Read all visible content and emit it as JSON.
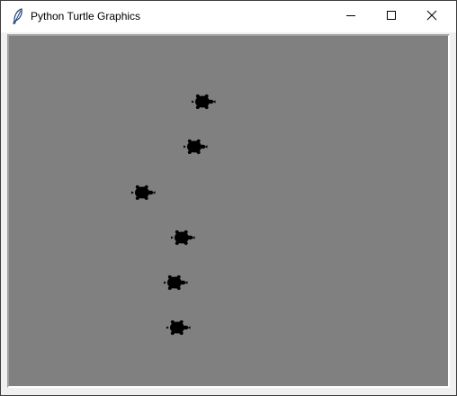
{
  "window": {
    "title": "Python Turtle Graphics",
    "icon": "feather-icon",
    "controls": [
      "minimize-icon",
      "maximize-icon",
      "close-icon"
    ]
  },
  "canvas": {
    "background": "#808080",
    "turtle_color": "#000000",
    "turtle_icon": "turtle-icon",
    "turtle_count": 6,
    "turtle_heading": "east"
  }
}
